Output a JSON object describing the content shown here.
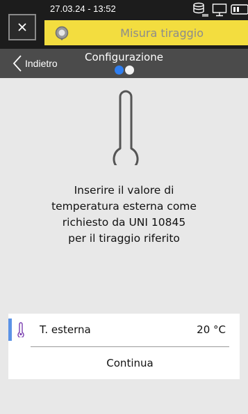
{
  "header": {
    "datetime": "27.03.24 - 13:52",
    "app_title": "Misura tiraggio"
  },
  "nav": {
    "back_label": "Indietro",
    "title": "Configurazione",
    "page_dots": [
      {
        "active": true,
        "color": "#2f7ef0"
      },
      {
        "active": false,
        "color": "#f2f2f2"
      }
    ]
  },
  "main": {
    "instruction_lines": [
      "Inserire il valore di",
      "temperatura esterna come",
      "richiesto da UNI 10845",
      "per il tiraggio riferito"
    ]
  },
  "panel": {
    "row_label": "T. esterna",
    "row_value": "20 °C",
    "continue_label": "Continua"
  },
  "colors": {
    "header_bg": "#1c1c1c",
    "title_bar": "#f3dd3f",
    "nav_bg": "#4b4b4b",
    "accent": "#5b93e6",
    "thermometer_icon": "#7a3fb0"
  },
  "icons": {
    "close": "close-icon",
    "app": "app-gauge-icon",
    "status": [
      "storage-icon",
      "monitor-icon",
      "battery-icon"
    ],
    "back": "chevron-left-icon",
    "thermometer": "thermometer-icon"
  }
}
